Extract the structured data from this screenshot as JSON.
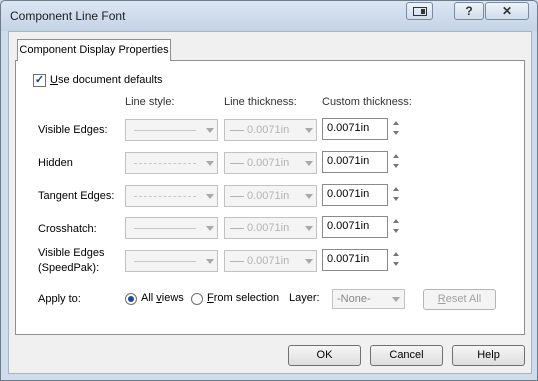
{
  "window": {
    "title": "Component Line Font",
    "help_glyph": "?",
    "close_glyph": "✕"
  },
  "tab": {
    "label": "Component Display Properties"
  },
  "use_defaults": {
    "label_u": "U",
    "label_rest": "se document defaults",
    "checked": true,
    "check_glyph": "✓"
  },
  "headers": {
    "line_style": "Line style:",
    "line_thickness": "Line thickness:",
    "custom_thickness": "Custom thickness:"
  },
  "rows": [
    {
      "label": "Visible Edges:",
      "style": "solid",
      "thickness": "0.0071in",
      "custom": "0.0071in"
    },
    {
      "label": "Hidden",
      "style": "dashed",
      "thickness": "0.0071in",
      "custom": "0.0071in"
    },
    {
      "label": "Tangent Edges:",
      "style": "longdash",
      "thickness": "0.0071in",
      "custom": "0.0071in"
    },
    {
      "label": "Crosshatch:",
      "style": "solid",
      "thickness": "0.0071in",
      "custom": "0.0071in"
    },
    {
      "label": "Visible Edges",
      "label2": "(SpeedPak):",
      "style": "solid",
      "thickness": "0.0071in",
      "custom": "0.0071in"
    }
  ],
  "apply": {
    "label": "Apply to:",
    "all_views_pre": "All ",
    "all_views_u": "v",
    "all_views_post": "iews",
    "from_sel_u": "F",
    "from_sel_post": "rom selection",
    "selected": "all_views",
    "layer_label": "Layer:",
    "layer_value": "-None-",
    "reset_u": "R",
    "reset_post": "eset All"
  },
  "buttons": {
    "ok": "OK",
    "cancel": "Cancel",
    "help": "Help"
  }
}
